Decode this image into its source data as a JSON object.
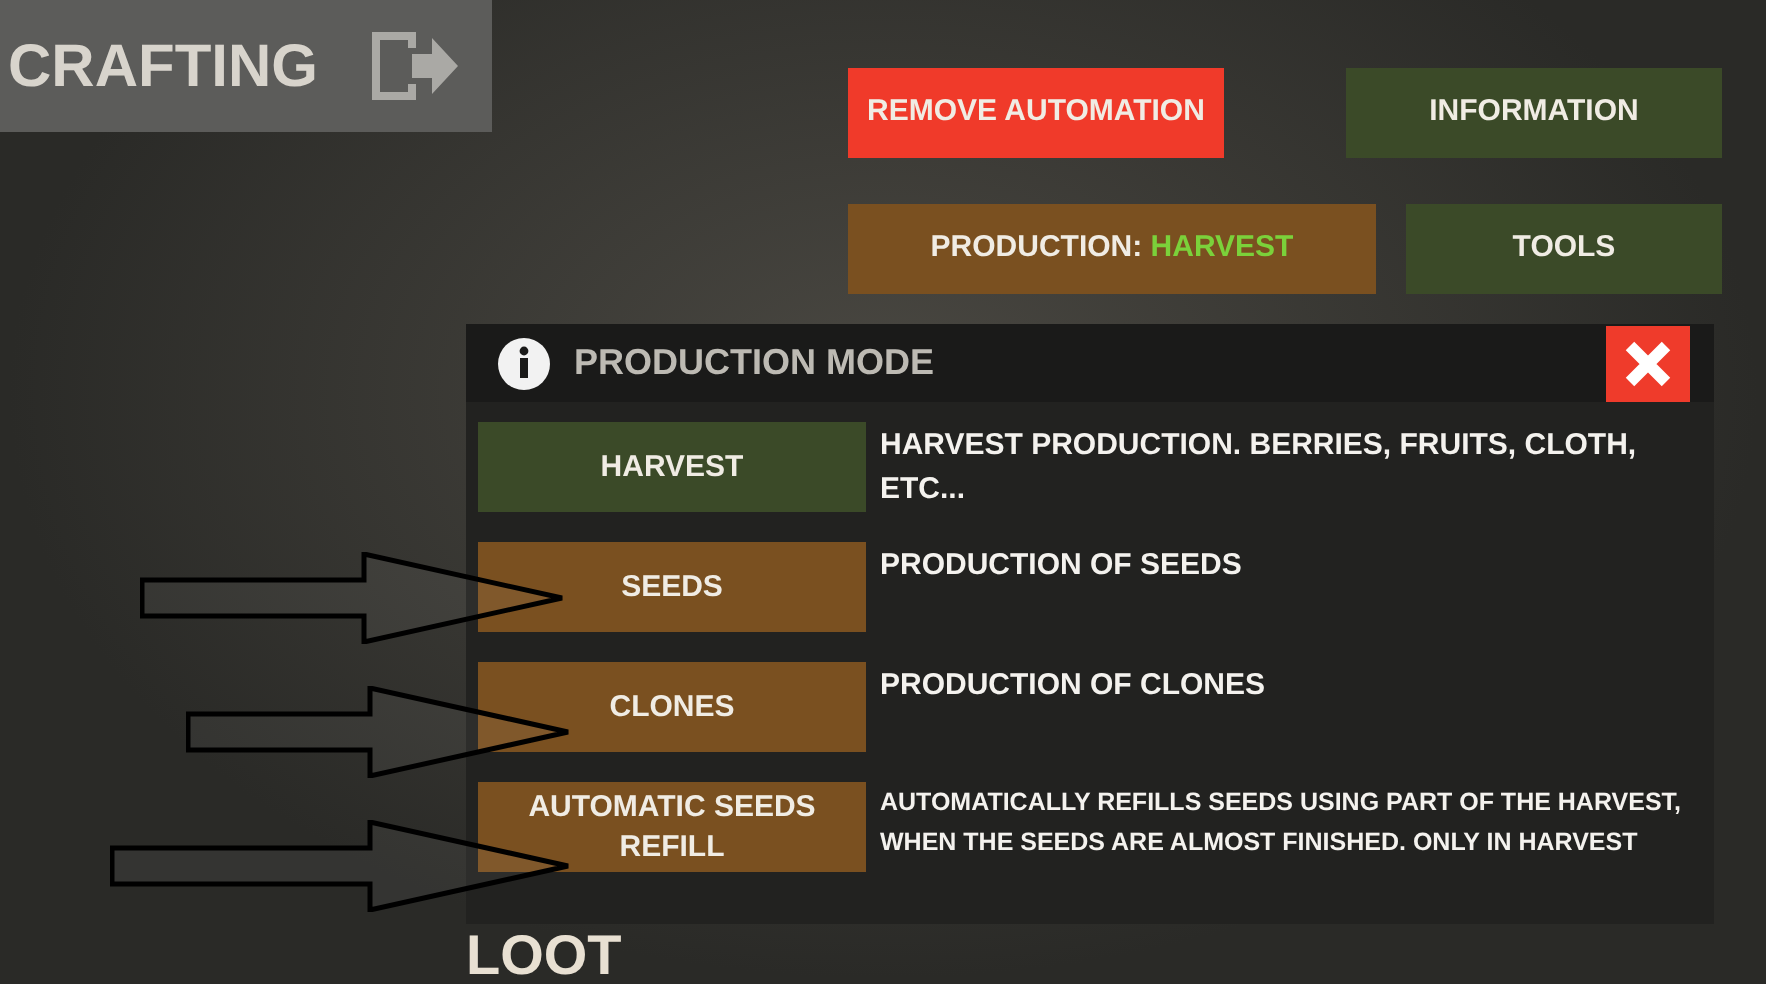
{
  "header": {
    "title": "CRAFTING"
  },
  "actions": [
    {
      "label": "REMOVE AUTOMATION",
      "kind": "danger"
    },
    {
      "label": "INFORMATION",
      "kind": "green"
    },
    {
      "label": "PRODUCTION: ",
      "value": "HARVEST",
      "kind": "production"
    },
    {
      "label": "TOOLS",
      "kind": "green"
    }
  ],
  "dialog": {
    "title": "PRODUCTION MODE",
    "modes": [
      {
        "label": "HARVEST",
        "selected": true,
        "description": "HARVEST PRODUCTION. BERRIES, FRUITS, CLOTH, ETC..."
      },
      {
        "label": "SEEDS",
        "selected": false,
        "description": "PRODUCTION OF SEEDS"
      },
      {
        "label": "CLONES",
        "selected": false,
        "description": "PRODUCTION OF CLONES"
      },
      {
        "label": "AUTOMATIC SEEDS REFILL",
        "selected": false,
        "description": "AUTOMATICALLY REFILLS SEEDS USING PART OF THE HARVEST, WHEN THE SEEDS ARE ALMOST FINISHED. ONLY IN HARVEST"
      }
    ]
  },
  "footer": {
    "title": "LOOT"
  }
}
